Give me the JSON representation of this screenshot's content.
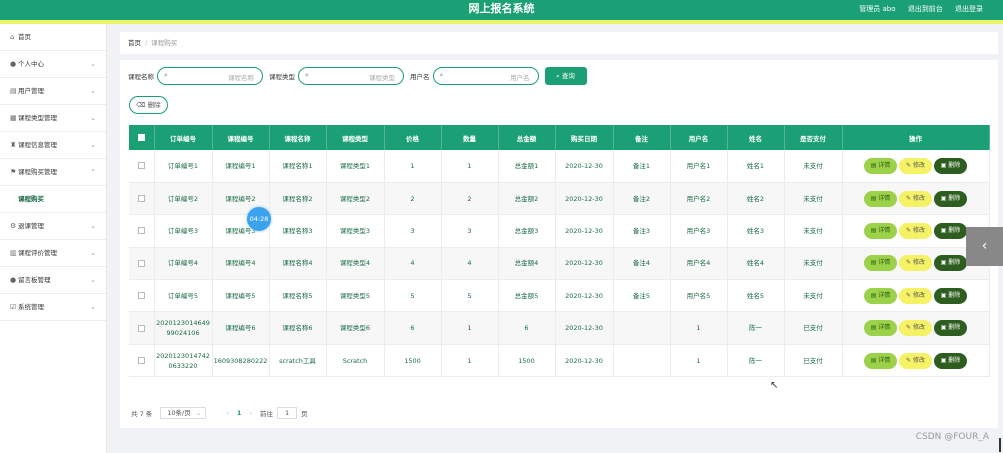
{
  "header": {
    "title": "网上报名系统",
    "actions": [
      "管理员 abo",
      "退出到前台",
      "退出登录"
    ]
  },
  "sidebar": {
    "items": [
      {
        "label": "首页",
        "icon": "home-icon",
        "glyph": "⌂"
      },
      {
        "label": "个人中心",
        "icon": "user-icon",
        "glyph": "●"
      },
      {
        "label": "用户管理",
        "icon": "list-icon",
        "glyph": "▤"
      },
      {
        "label": "课程类型管理",
        "icon": "grid-icon",
        "glyph": "▦"
      },
      {
        "label": "课程信息管理",
        "icon": "trophy-icon",
        "glyph": "♜"
      },
      {
        "label": "课程购买管理",
        "icon": "cart-icon",
        "glyph": "⚑"
      },
      {
        "label": "课程购买",
        "icon": "",
        "glyph": ""
      },
      {
        "label": "退课管理",
        "icon": "gear-icon",
        "glyph": "⚙"
      },
      {
        "label": "课程评价管理",
        "icon": "chart-icon",
        "glyph": "▥"
      },
      {
        "label": "留言板管理",
        "icon": "person-icon",
        "glyph": "●"
      },
      {
        "label": "系统管理",
        "icon": "settings-icon",
        "glyph": "☑"
      }
    ]
  },
  "breadcrumb": {
    "home": "首页",
    "sep": "/",
    "current": "课程购买"
  },
  "search": {
    "fields": [
      {
        "label": "课程名称",
        "placeholder": "课程名称"
      },
      {
        "label": "课程类型",
        "placeholder": "课程类型"
      },
      {
        "label": "用户名",
        "placeholder": "用户名"
      }
    ],
    "query_label": "查询",
    "delete_label": "删除"
  },
  "table": {
    "headers": [
      "订单编号",
      "课程编号",
      "课程名称",
      "课程类型",
      "价格",
      "数量",
      "总金额",
      "购买日期",
      "备注",
      "用户名",
      "姓名",
      "是否支付",
      "操作"
    ],
    "rows": [
      [
        "订单编号1",
        "课程编号1",
        "课程名称1",
        "课程类型1",
        "1",
        "1",
        "总金额1",
        "2020-12-30",
        "备注1",
        "用户名1",
        "姓名1",
        "未支付"
      ],
      [
        "订单编号2",
        "课程编号2",
        "课程名称2",
        "课程类型2",
        "2",
        "2",
        "总金额2",
        "2020-12-30",
        "备注2",
        "用户名2",
        "姓名2",
        "未支付"
      ],
      [
        "订单编号3",
        "课程编号3",
        "课程名称3",
        "课程类型3",
        "3",
        "3",
        "总金额3",
        "2020-12-30",
        "备注3",
        "用户名3",
        "姓名3",
        "未支付"
      ],
      [
        "订单编号4",
        "课程编号4",
        "课程名称4",
        "课程类型4",
        "4",
        "4",
        "总金额4",
        "2020-12-30",
        "备注4",
        "用户名4",
        "姓名4",
        "未支付"
      ],
      [
        "订单编号5",
        "课程编号5",
        "课程名称5",
        "课程类型5",
        "5",
        "5",
        "总金额5",
        "2020-12-30",
        "备注5",
        "用户名5",
        "姓名5",
        "未支付"
      ],
      [
        "2020123014649 99024106",
        "课程编号6",
        "课程名称6",
        "课程类型6",
        "6",
        "1",
        "6",
        "2020-12-30",
        "",
        "1",
        "陈一",
        "已支付"
      ],
      [
        "2020123014742 0633220",
        "1609308280222",
        "scratch工具",
        "Scratch",
        "1500",
        "1",
        "1500",
        "2020-12-30",
        "",
        "1",
        "陈一",
        "已支付"
      ]
    ],
    "actions": {
      "detail": "详情",
      "edit": "修改",
      "delete": "删除"
    }
  },
  "pagination": {
    "total": "共 7 条",
    "page_size": "10条/页",
    "current_page": "1",
    "goto_label": "前往",
    "goto_value": "1",
    "page_suffix": "页"
  },
  "overlay": {
    "timer": "04:28",
    "watermark": "CSDN @FOUR_A"
  },
  "colors": {
    "primary": "#1aa074",
    "accent_strip": "#e9f36a",
    "detail_btn": "#9cd14a",
    "edit_btn": "#f6f266",
    "delete_btn": "#2d5d1f"
  }
}
